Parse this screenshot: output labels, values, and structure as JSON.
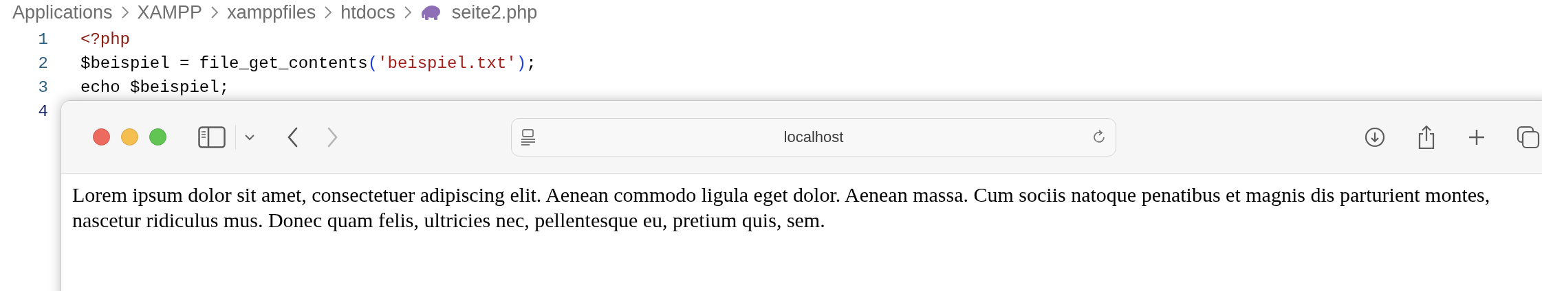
{
  "breadcrumb": [
    {
      "label": "Applications",
      "kind": "folder"
    },
    {
      "label": "XAMPP",
      "kind": "folder"
    },
    {
      "label": "xamppfiles",
      "kind": "folder"
    },
    {
      "label": "htdocs",
      "kind": "folder"
    },
    {
      "label": "seite2.php",
      "kind": "php"
    }
  ],
  "code_lines": [
    {
      "number": "1",
      "tokens": [
        {
          "text": "<?php",
          "kind": "tag"
        }
      ]
    },
    {
      "number": "2",
      "tokens": [
        {
          "text": "$beispiel = file_get_contents",
          "kind": "plain"
        },
        {
          "text": "(",
          "kind": "paren"
        },
        {
          "text": "'beispiel.txt'",
          "kind": "string"
        },
        {
          "text": ")",
          "kind": "paren"
        },
        {
          "text": ";",
          "kind": "plain"
        }
      ]
    },
    {
      "number": "3",
      "tokens": [
        {
          "text": "echo $beispiel;",
          "kind": "plain"
        }
      ]
    },
    {
      "number": "4"
    }
  ],
  "browser": {
    "nav": [
      {
        "kind": "back",
        "disabled": false
      },
      {
        "kind": "forward",
        "disabled": true
      }
    ],
    "address": "localhost",
    "page_text": "Lorem ipsum dolor sit amet, consectetuer adipiscing elit. Aenean commodo ligula eget dolor. Aenean massa. Cum sociis natoque penatibus et magnis dis parturient montes, nascetur ridiculus mus. Donec quam felis, ultricies nec, pellentesque eu, pretium quis, sem."
  }
}
